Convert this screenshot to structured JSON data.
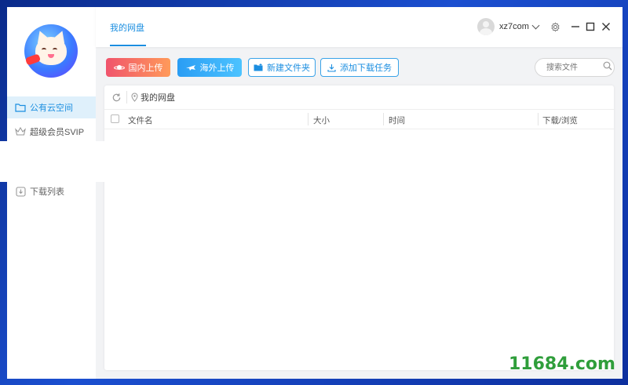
{
  "sidebar": {
    "items": [
      {
        "label": "公有云空间",
        "icon": "folder-icon"
      },
      {
        "label": "超级会员SVIP",
        "icon": "crown-icon"
      },
      {
        "label": "下载列表",
        "icon": "download-list-icon"
      }
    ]
  },
  "header": {
    "tab": "我的网盘",
    "username": "xz7com"
  },
  "toolbar": {
    "domestic_upload": "国内上传",
    "overseas_upload": "海外上传",
    "new_folder": "新建文件夹",
    "add_download": "添加下载任务",
    "search_placeholder": "搜索文件"
  },
  "panel": {
    "path": "我的网盘",
    "columns": [
      "文件名",
      "大小",
      "时间",
      "下载/浏览"
    ]
  },
  "watermark": "11684.com",
  "colors": {
    "accent": "#1b8ee0",
    "domestic_btn": "#f0546c",
    "overseas_btn": "#2a9df4",
    "desktop_bg": "#1b4fd0"
  }
}
